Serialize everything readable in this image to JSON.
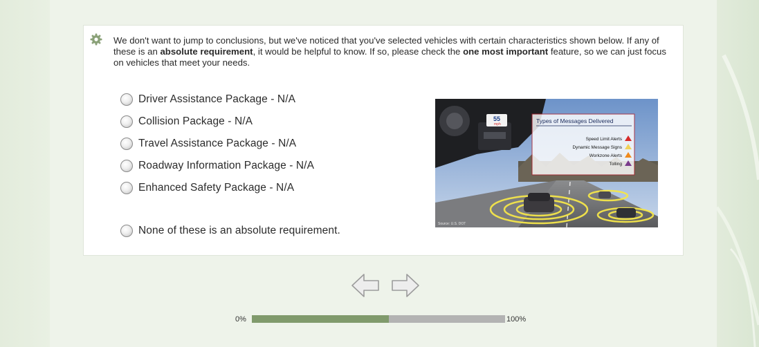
{
  "question": {
    "text_part1": "We don't want to jump to conclusions, but we've noticed that you've selected vehicles with certain characteristics shown below. If any of these is an ",
    "bold1": "absolute requirement",
    "text_part2": ", it would be helpful to know. If so, please check the ",
    "bold2": "one most important",
    "text_part3": " feature, so we can just focus on vehicles that meet your needs."
  },
  "options": [
    {
      "label": "Driver Assistance Package - N/A",
      "selected": false
    },
    {
      "label": "Collision Package - N/A",
      "selected": false
    },
    {
      "label": "Travel Assistance Package - N/A",
      "selected": false
    },
    {
      "label": "Roadway Information Package - N/A",
      "selected": false
    },
    {
      "label": "Enhanced Safety Package - N/A",
      "selected": false
    },
    {
      "label": "None of these is an absolute requirement.",
      "selected": false
    }
  ],
  "illustration": {
    "speed_value": "55",
    "speed_unit": "mph",
    "legend_title": "Types of Messages Delivered",
    "legend_items": [
      {
        "label": "Speed Limit Alerts",
        "color": "#d62a2a"
      },
      {
        "label": "Dynamic Message Signs",
        "color": "#f1d25a"
      },
      {
        "label": "Workzone Alerts",
        "color": "#f08a1e"
      },
      {
        "label": "Tolling",
        "color": "#7a3a8c"
      }
    ],
    "source": "Source: U.S. DOT"
  },
  "navigation": {
    "back_icon": "arrow-left-icon",
    "next_icon": "arrow-right-icon"
  },
  "progress": {
    "start_label": "0%",
    "end_label": "100%",
    "value_percent": 54,
    "fill_color": "#809a6c",
    "track_color": "#b3b3b3"
  },
  "colors": {
    "page_background": "#e6eee0",
    "card_background": "#ffffff"
  }
}
